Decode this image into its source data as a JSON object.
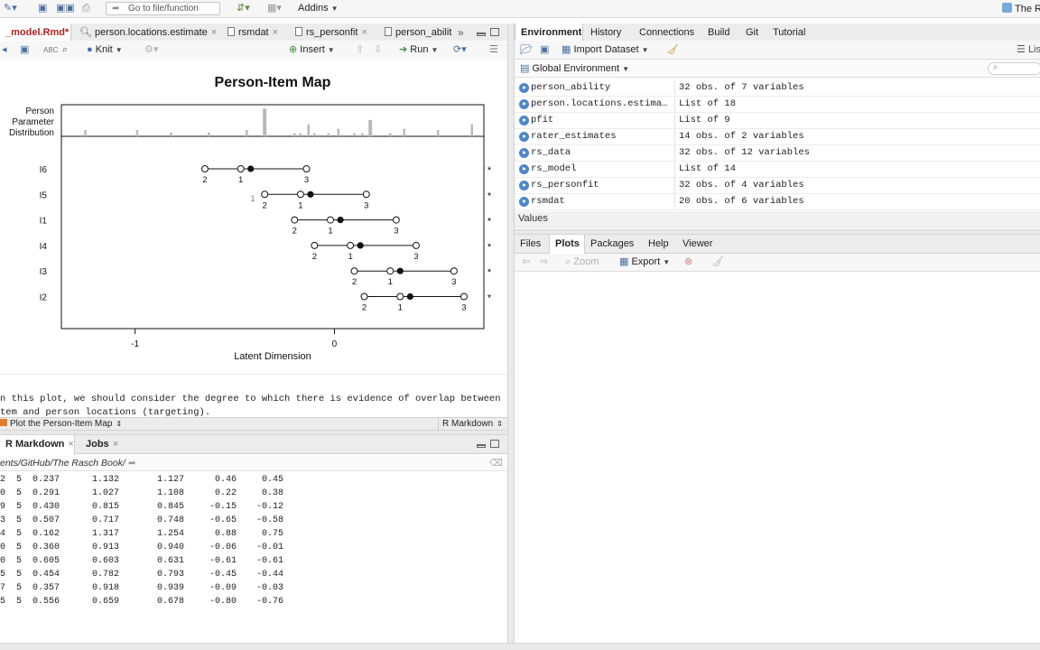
{
  "toolbar": {
    "goto_placeholder": "Go to file/function",
    "addins_label": "Addins",
    "project_label": "The Ra"
  },
  "source_tabs": [
    {
      "label": "_model.Rmd*"
    },
    {
      "label": "person.locations.estimate"
    },
    {
      "label": "rsmdat"
    },
    {
      "label": "rs_personfit"
    },
    {
      "label": "person_abilit"
    }
  ],
  "source_toolbar": {
    "knit_label": "Knit",
    "insert_label": "Insert",
    "run_label": "Run"
  },
  "pim": {
    "title": "Person-Item Map",
    "person_label_lines": [
      "Person",
      "Parameter",
      "Distribution"
    ],
    "xlabel": "Latent Dimension",
    "x_ticks": [
      {
        "value": -1,
        "label": "-1"
      },
      {
        "value": 0,
        "label": "0"
      }
    ],
    "xlim": [
      -1.37,
      0.75
    ],
    "histogram": [
      {
        "x": -1.25,
        "h": 0.2
      },
      {
        "x": -0.99,
        "h": 0.2
      },
      {
        "x": -0.82,
        "h": 0.12
      },
      {
        "x": -0.63,
        "h": 0.12
      },
      {
        "x": -0.44,
        "h": 0.2
      },
      {
        "x": -0.35,
        "h": 0.88
      },
      {
        "x": -0.2,
        "h": 0.1
      },
      {
        "x": -0.17,
        "h": 0.1
      },
      {
        "x": -0.13,
        "h": 0.38
      },
      {
        "x": -0.1,
        "h": 0.1
      },
      {
        "x": -0.03,
        "h": 0.1
      },
      {
        "x": 0.02,
        "h": 0.24
      },
      {
        "x": 0.1,
        "h": 0.1
      },
      {
        "x": 0.14,
        "h": 0.1
      },
      {
        "x": 0.18,
        "h": 0.52
      },
      {
        "x": 0.28,
        "h": 0.1
      },
      {
        "x": 0.35,
        "h": 0.24
      },
      {
        "x": 0.52,
        "h": 0.2
      },
      {
        "x": 0.69,
        "h": 0.38
      }
    ],
    "items": [
      {
        "name": "I6",
        "t2": -0.65,
        "t1": -0.47,
        "mean": -0.42,
        "t3": -0.14
      },
      {
        "name": "I5",
        "t2": -0.35,
        "t1": -0.17,
        "mean": -0.12,
        "t3": 0.16
      },
      {
        "name": "I1",
        "t2": -0.2,
        "t1": -0.02,
        "mean": 0.03,
        "t3": 0.31
      },
      {
        "name": "I4",
        "t2": -0.1,
        "t1": 0.08,
        "mean": 0.13,
        "t3": 0.41
      },
      {
        "name": "I3",
        "t2": 0.1,
        "t1": 0.28,
        "mean": 0.33,
        "t3": 0.6
      },
      {
        "name": "I2",
        "t2": 0.15,
        "t1": 0.33,
        "mean": 0.38,
        "t3": 0.65
      }
    ],
    "threshold_labels": [
      "2",
      "1",
      "3"
    ],
    "star": "*",
    "stray_label": "1"
  },
  "editor": {
    "line1": "n this plot, we should consider the degree to which there is evidence of overlap between",
    "line2": "tem and person locations (targeting)."
  },
  "status": {
    "chunk": "Plot the Person-Item Map",
    "mode": "R Markdown"
  },
  "console_tabs": [
    {
      "label": "R Markdown"
    },
    {
      "label": "Jobs"
    }
  ],
  "console_path": "ents/GitHub/The Rasch Book/",
  "console_rows": [
    [
      "2",
      "5",
      "0.237",
      "1.132",
      "1.127",
      "0.46",
      "0.45"
    ],
    [
      "0",
      "5",
      "0.291",
      "1.027",
      "1.108",
      "0.22",
      "0.38"
    ],
    [
      "9",
      "5",
      "0.430",
      "0.815",
      "0.845",
      "-0.15",
      "-0.12"
    ],
    [
      "3",
      "5",
      "0.507",
      "0.717",
      "0.748",
      "-0.65",
      "-0.58"
    ],
    [
      "4",
      "5",
      "0.162",
      "1.317",
      "1.254",
      "0.88",
      "0.75"
    ],
    [
      "0",
      "5",
      "0.360",
      "0.913",
      "0.940",
      "-0.06",
      "-0.01"
    ],
    [
      "0",
      "5",
      "0.605",
      "0.603",
      "0.631",
      "-0.61",
      "-0.61"
    ],
    [
      "5",
      "5",
      "0.454",
      "0.782",
      "0.793",
      "-0.45",
      "-0.44"
    ],
    [
      "7",
      "5",
      "0.357",
      "0.918",
      "0.939",
      "-0.09",
      "-0.03"
    ],
    [
      "5",
      "5",
      "0.556",
      "0.659",
      "0.678",
      "-0.80",
      "-0.76"
    ]
  ],
  "env_tabs": [
    {
      "label": "Environment"
    },
    {
      "label": "History"
    },
    {
      "label": "Connections"
    },
    {
      "label": "Build"
    },
    {
      "label": "Git"
    },
    {
      "label": "Tutorial"
    }
  ],
  "env_toolbar": {
    "import_label": "Import Dataset",
    "list_label": "Lis",
    "scope_label": "Global Environment"
  },
  "env_rows": [
    {
      "name": "person_ability",
      "value": "32 obs. of 7 variables"
    },
    {
      "name": "person.locations.estima…",
      "value": "List of 18"
    },
    {
      "name": "pfit",
      "value": "List of 9"
    },
    {
      "name": "rater_estimates",
      "value": "14 obs. of 2 variables"
    },
    {
      "name": "rs_data",
      "value": "32 obs. of 12 variables"
    },
    {
      "name": "rs_model",
      "value": "List of 14"
    },
    {
      "name": "rs_personfit",
      "value": "32 obs. of 4 variables"
    },
    {
      "name": "rsmdat",
      "value": "20 obs. of 6 variables"
    }
  ],
  "values_header": "Values",
  "files_tabs": [
    {
      "label": "Files"
    },
    {
      "label": "Plots"
    },
    {
      "label": "Packages"
    },
    {
      "label": "Help"
    },
    {
      "label": "Viewer"
    }
  ],
  "plots_toolbar": {
    "zoom_label": "Zoom",
    "export_label": "Export"
  }
}
